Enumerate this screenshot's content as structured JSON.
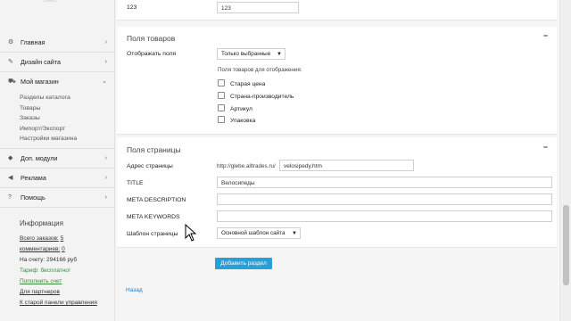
{
  "sidebar": {
    "nav": [
      {
        "label": "Главная",
        "icon": "gear-icon",
        "chevron": "›"
      },
      {
        "label": "Дизайн сайта",
        "icon": "brush-icon",
        "chevron": "›"
      },
      {
        "label": "Мой магазин",
        "icon": "cart-icon",
        "chevron": "⌄"
      }
    ],
    "shop_sub": [
      "Разделы каталога",
      "Товары",
      "Заказы",
      "Импорт/Экспорт",
      "Настройки магазина"
    ],
    "nav2": [
      {
        "label": "Доп. модули",
        "icon": "puzzle-icon",
        "chevron": "›"
      },
      {
        "label": "Реклама",
        "icon": "megaphone-icon",
        "chevron": "›"
      },
      {
        "label": "Помощь",
        "icon": "help-icon",
        "chevron": "›"
      }
    ],
    "info": {
      "title": "Информация",
      "orders_label": "Всего заказов:",
      "orders_value": "5",
      "comments_label": "комментариев:",
      "comments_value": "0",
      "balance_label": "На счету:",
      "balance_value": "294166 руб",
      "tariff": "Тариф: бесплатно!",
      "topup": "Пополнить счет",
      "partners": "Для партнеров",
      "old_panel": "К старой панели управления"
    }
  },
  "top_field": {
    "label": "123",
    "value": "123"
  },
  "product_fields": {
    "title": "Поля товаров",
    "collapse": "−",
    "show_label": "Отображать поля",
    "show_select": "Только выбранные",
    "fields_caption": "Поля товаров для отображения:",
    "checkboxes": [
      "Старая цена",
      "Страна-производитель",
      "Артикул",
      "Упаковка"
    ]
  },
  "page_fields": {
    "title": "Поля страницы",
    "collapse": "−",
    "address_label": "Адрес страницы",
    "address_prefix": "http://glebe.alltrades.ru/",
    "address_value": "velosipedy.htm",
    "title_label": "TITLE",
    "title_value": "Велосипеды",
    "meta_desc_label": "META DESCRIPTION",
    "meta_desc_value": "",
    "meta_kw_label": "META KEYWORDS",
    "meta_kw_value": "",
    "template_label": "Шаблон страницы",
    "template_value": "Основной шаблон сайта"
  },
  "actions": {
    "add_button": "Добавить раздел",
    "back_link": "Назад"
  }
}
